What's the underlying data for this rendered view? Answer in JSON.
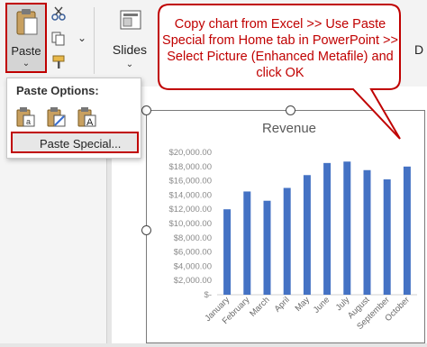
{
  "ribbon": {
    "paste_label": "Paste",
    "slides_label": "Slides",
    "right_partial_label": "D"
  },
  "paste_options": {
    "title": "Paste Options:",
    "icons": [
      "paste-use-destination-theme-icon",
      "paste-keep-source-formatting-icon",
      "paste-keep-text-only-icon"
    ],
    "paste_special_label": "Paste Special..."
  },
  "callout": {
    "text": "Copy chart from Excel >> Use Paste Special from Home tab in PowerPoint >> Select Picture (Enhanced Metafile) and click OK",
    "color": "#c00000"
  },
  "chart_data": {
    "type": "bar",
    "title": "Revenue",
    "categories": [
      "January",
      "February",
      "March",
      "April",
      "May",
      "June",
      "July",
      "August",
      "September",
      "October"
    ],
    "values": [
      12000,
      14500,
      13200,
      15000,
      16800,
      18500,
      18700,
      17500,
      16200,
      18000
    ],
    "ylim": [
      0,
      20000
    ],
    "yticks": [
      "$-",
      "$2,000.00",
      "$4,000.00",
      "$6,000.00",
      "$8,000.00",
      "$10,000.00",
      "$12,000.00",
      "$14,000.00",
      "$16,000.00",
      "$18,000.00",
      "$20,000.00"
    ],
    "bar_color": "#4472c4",
    "grid": false
  }
}
